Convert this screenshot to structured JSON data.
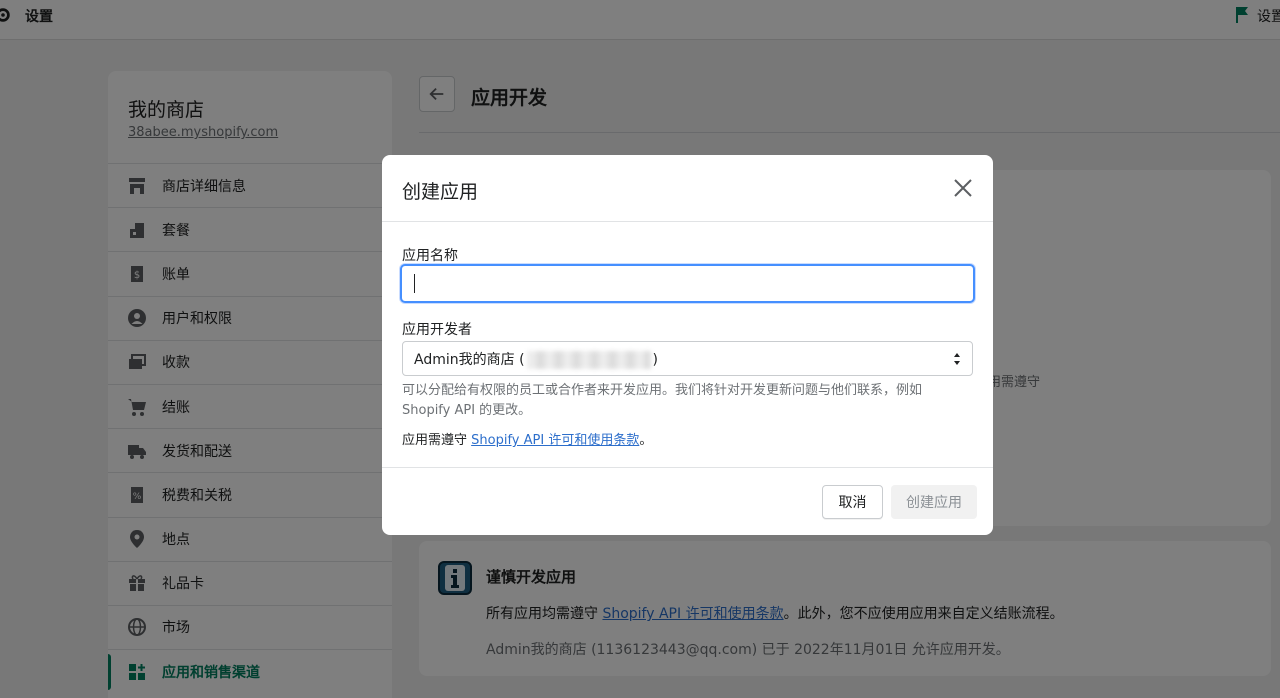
{
  "topbar": {
    "title": "设置",
    "right_label": "设置"
  },
  "sidebar": {
    "store_name": "我的商店",
    "store_url": "38abee.myshopify.com",
    "items": [
      {
        "label": "商店详细信息",
        "icon": "store-icon"
      },
      {
        "label": "套餐",
        "icon": "plan-icon"
      },
      {
        "label": "账单",
        "icon": "billing-icon"
      },
      {
        "label": "用户和权限",
        "icon": "user-icon"
      },
      {
        "label": "收款",
        "icon": "payments-icon"
      },
      {
        "label": "结账",
        "icon": "cart-icon"
      },
      {
        "label": "发货和配送",
        "icon": "truck-icon"
      },
      {
        "label": "税费和关税",
        "icon": "tax-icon"
      },
      {
        "label": "地点",
        "icon": "location-icon"
      },
      {
        "label": "礼品卡",
        "icon": "gift-icon"
      },
      {
        "label": "市场",
        "icon": "globe-icon"
      },
      {
        "label": "应用和销售渠道",
        "icon": "apps-icon",
        "active": true
      }
    ]
  },
  "main": {
    "title": "应用开发",
    "card1_partial": "用需遵守",
    "card2": {
      "title": "谨慎开发应用",
      "line1_prefix": "所有应用均需遵守 ",
      "line1_link": "Shopify API 许可和使用条款",
      "line1_suffix": "。此外，您不应使用应用来自定义结账流程。",
      "line2": "Admin我的商店 (1136123443@qq.com) 已于 2022年11月01日 允许应用开发。"
    }
  },
  "modal": {
    "title": "创建应用",
    "name_label": "应用名称",
    "name_value": "",
    "developer_label": "应用开发者",
    "developer_prefix": "Admin我的商店 (",
    "developer_suffix": ")",
    "help_text": "可以分配给有权限的员工或合作者来开发应用。我们将针对开发更新问题与他们联系，例如 Shopify API 的更改。",
    "terms_prefix": "应用需遵守 ",
    "terms_link": "Shopify API 许可和使用条款",
    "terms_suffix": "。",
    "cancel_label": "取消",
    "create_label": "创建应用"
  },
  "colors": {
    "accent": "#008060",
    "link": "#2c6ecb",
    "focus": "#458fff"
  }
}
